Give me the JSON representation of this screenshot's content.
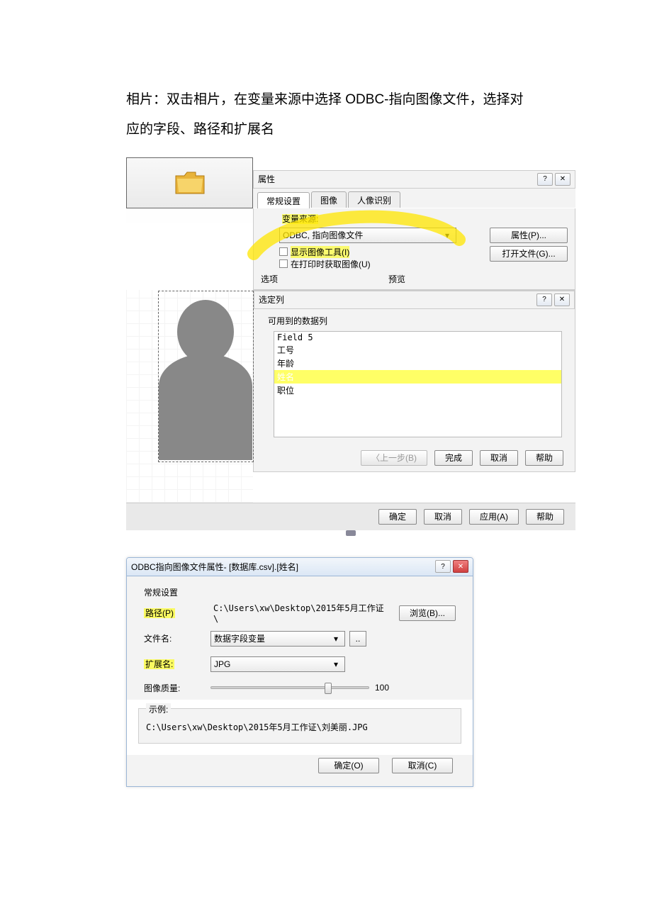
{
  "instruction": "相片：双击相片，在变量来源中选择 ODBC-指向图像文件，选择对应的字段、路径和扩展名",
  "dlg1": {
    "title": "属性",
    "tabs": {
      "general": "常规设置",
      "image": "图像",
      "face": "人像识别"
    },
    "varsrc_label": "变量来源:",
    "varsrc_value": "ODBC, 指向图像文件",
    "btn_prop": "属性(P)...",
    "chk_showtool": "显示图像工具(I)",
    "chk_onprint": "在打印时获取图像(U)",
    "btn_open": "打开文件(G)...",
    "opt_label": "选项",
    "preview_label": "预览"
  },
  "dlg2": {
    "title": "选定列",
    "avail_label": "可用到的数据列",
    "items": [
      "Field 5",
      "工号",
      "年龄",
      "姓名",
      "职位"
    ],
    "btn_back": "〈上一步(B)",
    "btn_finish": "完成",
    "btn_cancel": "取消",
    "btn_help": "帮助"
  },
  "foot": {
    "ok": "确定",
    "cancel": "取消",
    "apply": "应用(A)",
    "help": "帮助"
  },
  "dlg3": {
    "title": "ODBC指向图像文件属性- [数据库.csv].[姓名]",
    "section": "常规设置",
    "path_label": "路径(P)",
    "path_value": "C:\\Users\\xw\\Desktop\\2015年5月工作证\\",
    "browse": "浏览(B)...",
    "fname_label": "文件名:",
    "fname_value": "数据字段变量",
    "ext_label": "扩展名:",
    "ext_value": "JPG",
    "quality_label": "图像质量:",
    "quality_value": "100",
    "example_label": "示例:",
    "example_value": "C:\\Users\\xw\\Desktop\\2015年5月工作证\\刘美丽.JPG",
    "ok": "确定(O)",
    "cancel": "取消(C)"
  }
}
